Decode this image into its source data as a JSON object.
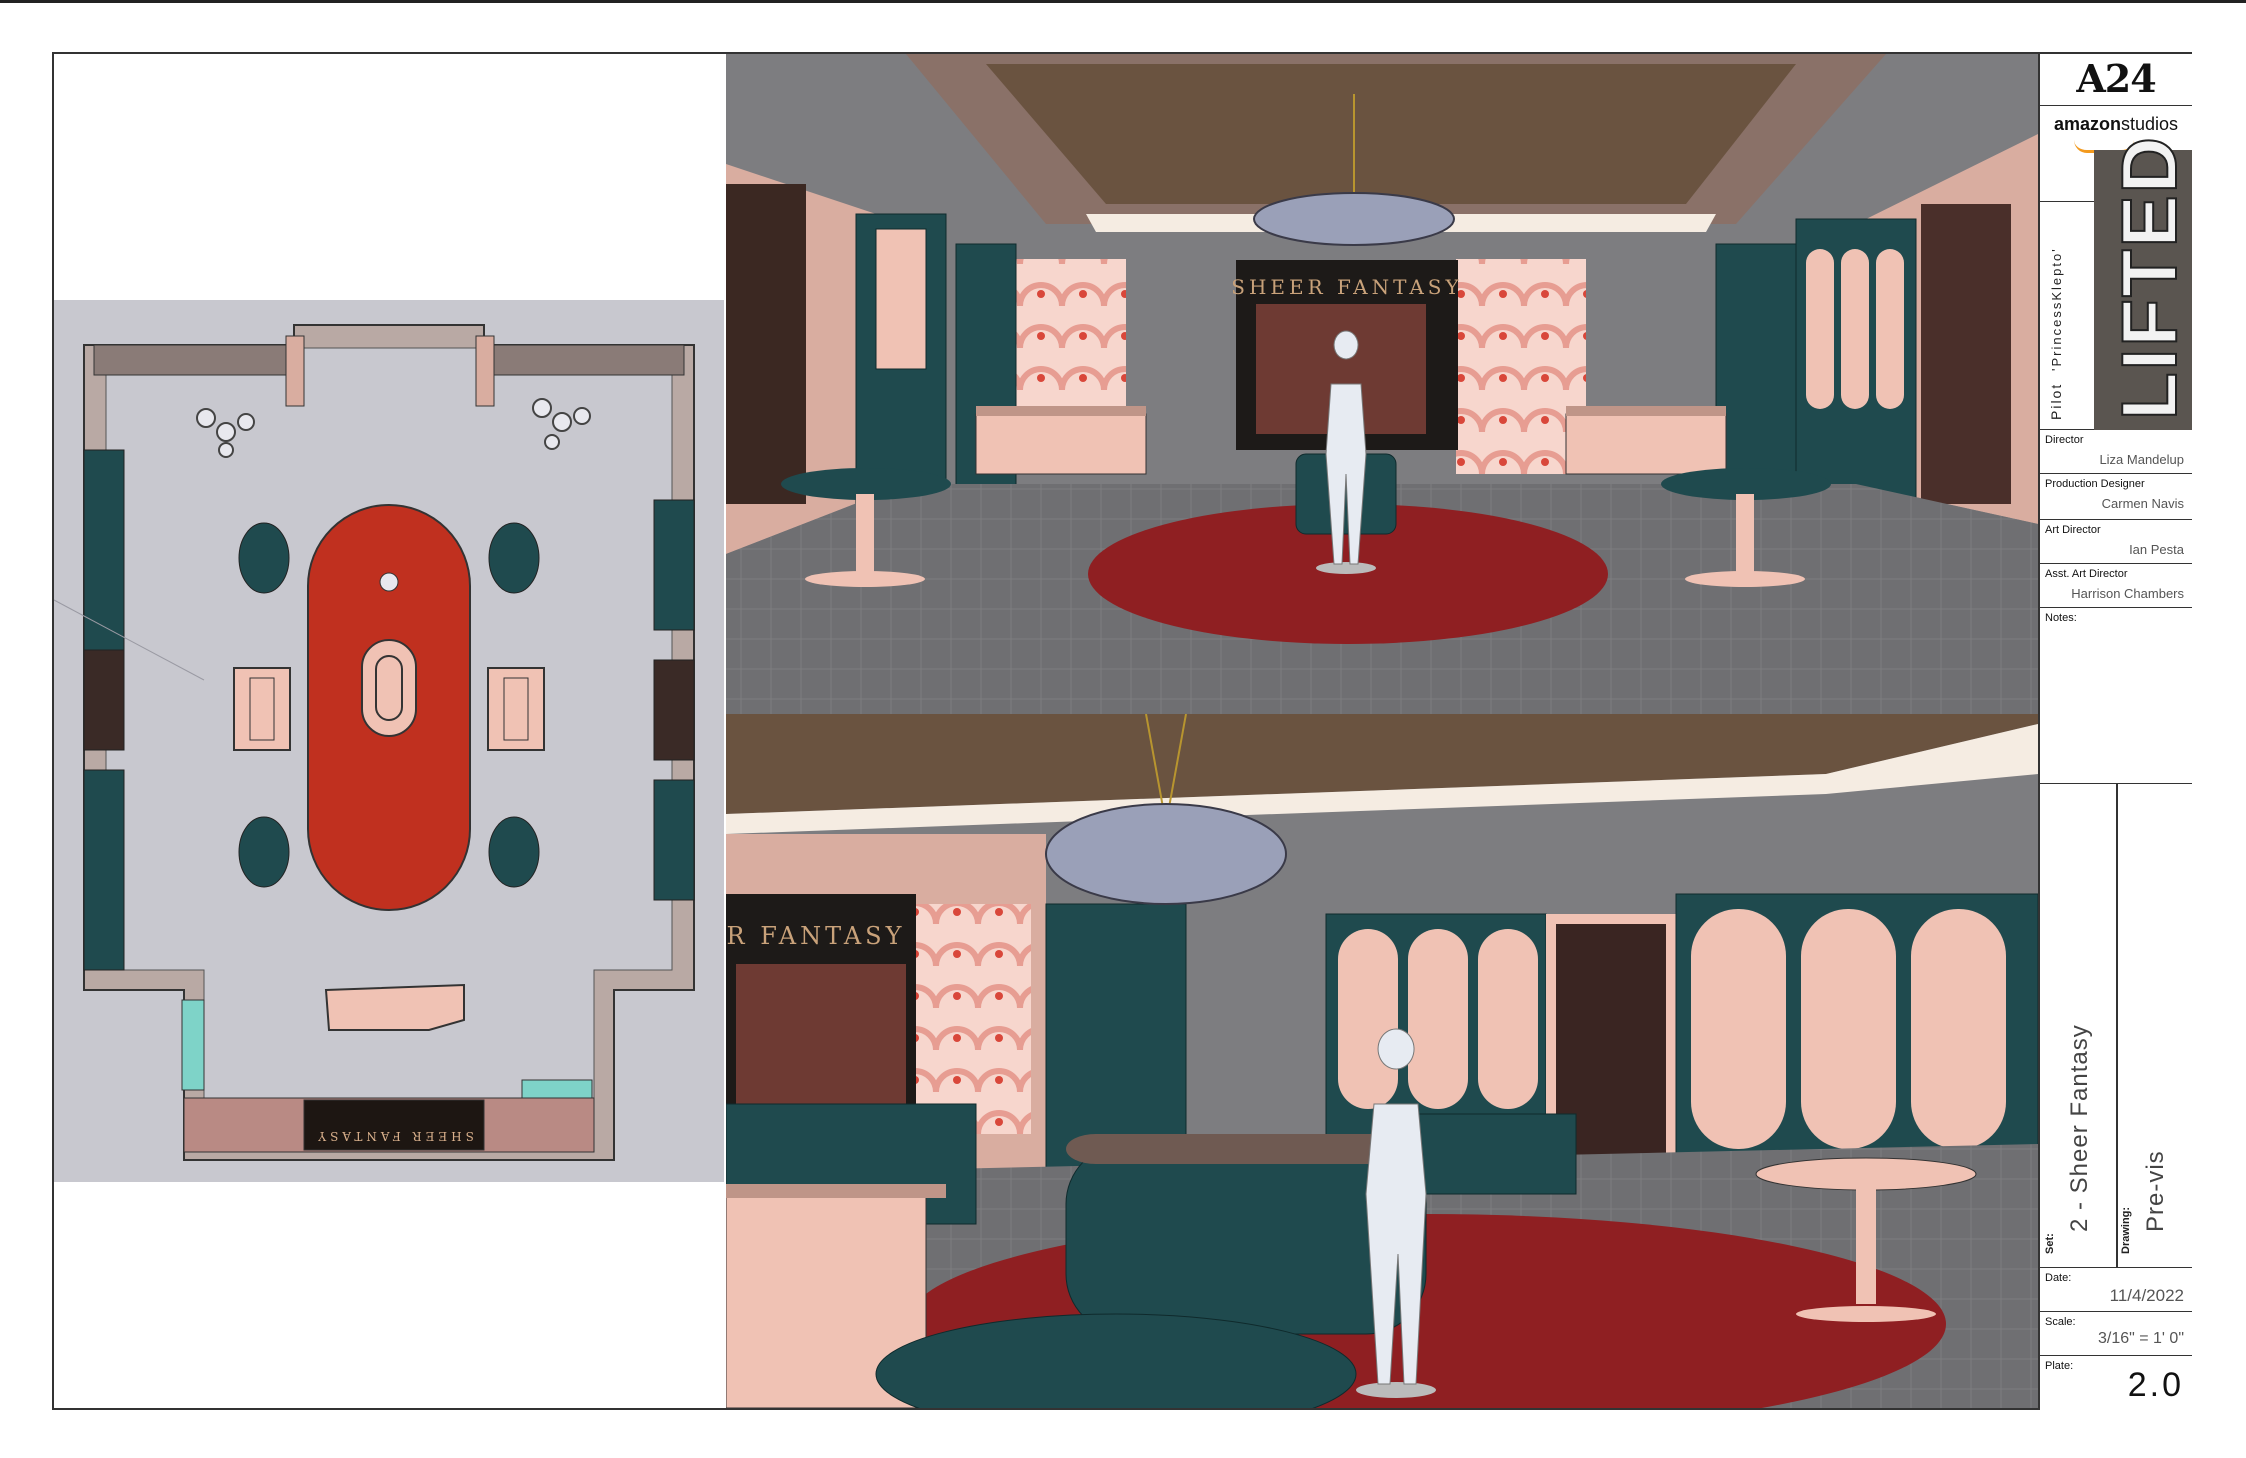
{
  "title_block": {
    "logo_primary": "A24",
    "logo_secondary_bold": "amazon",
    "logo_secondary_light": "studios",
    "episode_label": "Pilot",
    "episode_title": "'PrincessKlepto'",
    "show_title": "LIFTED",
    "director_label": "Director",
    "director": "Liza Mandelup",
    "production_designer_label": "Production Designer",
    "production_designer": "Carmen Navis",
    "art_director_label": "Art Director",
    "art_director": "Ian Pesta",
    "asst_art_director_label": "Asst. Art Director",
    "asst_art_director": "Harrison Chambers",
    "notes_label": "Notes:",
    "set_label": "Set:",
    "set_value": "2 - Sheer Fantasy",
    "drawing_label": "Drawing:",
    "drawing_value": "Pre-vis",
    "date_label": "Date:",
    "date_value": "11/4/2022",
    "scale_label": "Scale:",
    "scale_value": "3/16\" = 1' 0\"",
    "plate_label": "Plate:",
    "plate_value": "2.0"
  },
  "renders": {
    "store_sign_top": "SHEER FANTASY",
    "store_sign_bottom": "R FANTASY",
    "entry_mat_text": "SHEER FANTASY"
  },
  "colors": {
    "teal": "#1f4a4e",
    "blush": "#f0c2b4",
    "carpet_red": "#8f1f22",
    "floor_grey": "#6f6f72",
    "ceiling_brown": "#6a5340",
    "plan_floor": "#c8c8cf",
    "plan_rug": "#c0301f"
  }
}
